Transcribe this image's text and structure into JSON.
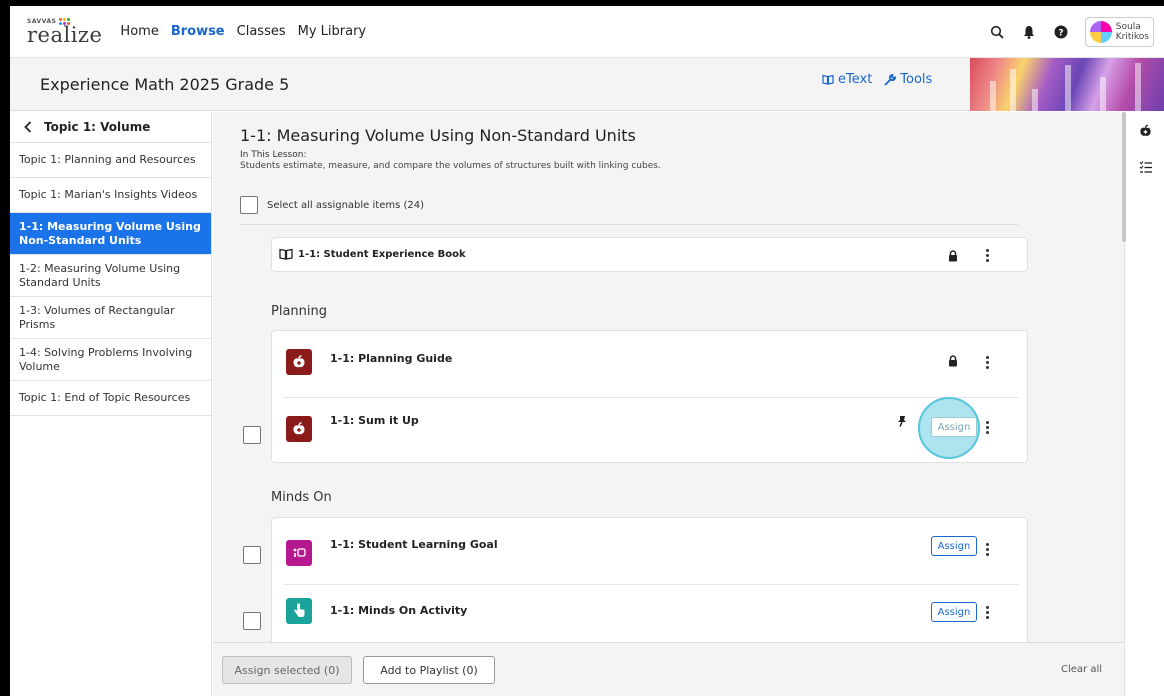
{
  "nav": {
    "logo_top": "SAVVAS",
    "logo_main": "realize",
    "links": [
      {
        "label": "Home",
        "active": false
      },
      {
        "label": "Browse",
        "active": true
      },
      {
        "label": "Classes",
        "active": false
      },
      {
        "label": "My Library",
        "active": false
      }
    ],
    "user_first": "Soula",
    "user_last": "Kritikos"
  },
  "header": {
    "course_title": "Experience Math 2025 Grade 5",
    "etext_label": "eText",
    "tools_label": "Tools"
  },
  "sidebar": {
    "heading": "Topic 1: Volume",
    "items": [
      {
        "label": "Topic 1: Planning and Resources",
        "active": false
      },
      {
        "label": "Topic 1: Marian's Insights Videos",
        "active": false
      },
      {
        "label": "1-1: Measuring Volume Using Non-Standard Units",
        "active": true
      },
      {
        "label": "1-2: Measuring Volume Using Standard Units",
        "active": false
      },
      {
        "label": "1-3: Volumes of Rectangular Prisms",
        "active": false
      },
      {
        "label": "1-4: Solving Problems Involving Volume",
        "active": false
      },
      {
        "label": "Topic 1: End of Topic Resources",
        "active": false
      }
    ]
  },
  "lesson": {
    "title": "1-1: Measuring Volume Using Non-Standard Units",
    "subtitle": "In This Lesson:",
    "description": "Students estimate, measure, and compare the volumes of structures built with linking cubes.",
    "select_all": "Select all assignable items (24)",
    "book_item": "1-1: Student Experience Book",
    "sections": [
      {
        "title": "Planning",
        "items": [
          {
            "title": "1-1: Planning Guide",
            "icon": "apple-icon",
            "color": "#8b1a1a",
            "assign": null
          },
          {
            "title": "1-1: Sum it Up",
            "icon": "apple-icon",
            "color": "#8b1a1a",
            "assign": "Assign"
          }
        ]
      },
      {
        "title": "Minds On",
        "items": [
          {
            "title": "1-1: Student Learning Goal",
            "icon": "goal-icon",
            "color": "#b5188f",
            "assign": "Assign"
          },
          {
            "title": "1-1: Minds On Activity",
            "icon": "hand-pointer-icon",
            "color": "#1aa39a",
            "assign": "Assign"
          }
        ]
      }
    ]
  },
  "bottom": {
    "assign_selected": "Assign selected (0)",
    "add_to_playlist": "Add to Playlist (0)",
    "clear_all": "Clear all"
  }
}
